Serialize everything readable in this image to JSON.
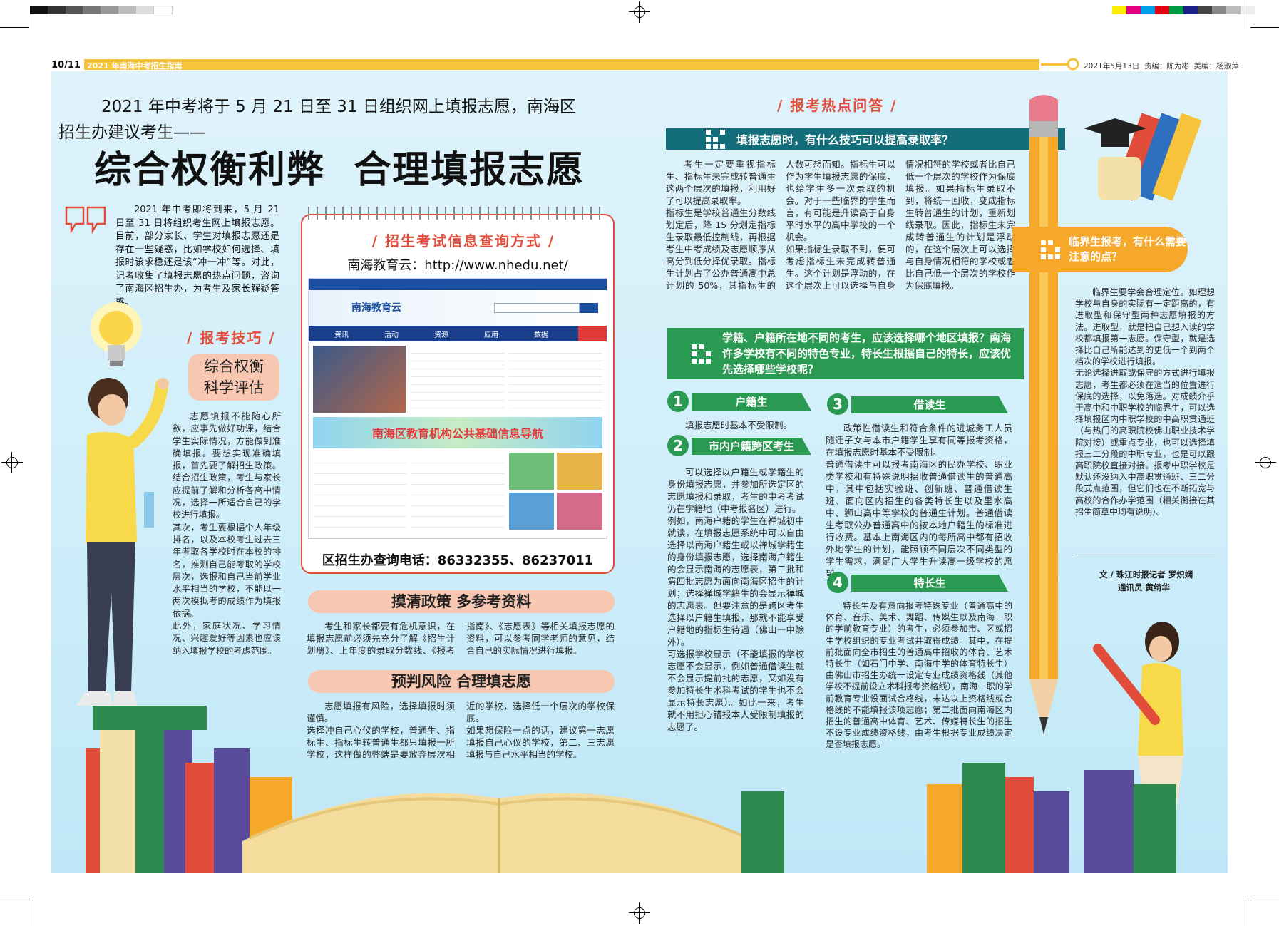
{
  "header": {
    "page_num": "10/11",
    "section": "2021 年南海中考招生指南",
    "date": "2021年5月13日",
    "editor": "责编：陈为彬",
    "designer": "美编：杨淑萍"
  },
  "headline": {
    "intro_line1": "2021 年中考将于 5 月 21 日至 31 日组织网上填报志愿，南海区",
    "intro_line2": "招生办建议考生——",
    "main": "综合权衡利弊  合理填报志愿"
  },
  "lead": "2021 年中考即将到来，5 月 21 日至 31 日将组织考生网上填报志愿。目前，部分家长、学生对填报志愿还是存在一些疑惑，比如学校如何选择、填报时该求稳还是该“冲一冲”等。对此，记者收集了填报志愿的热点问题，咨询了南海区招生办，为考生及家长解疑答惑。",
  "tips": {
    "label": "/ 报考技巧 /",
    "pill": "综合权衡\n科学评估",
    "text": "志愿填报不能随心所欲，应事先做好功课，结合学生实际情况，方能做到准确填报。要想实现准确填报，首先要了解招生政策。结合招生政策，考生与家长应提前了解和分析各高中情况，选择一所适合自己的学校进行填报。\n其次，考生要根据个人年级排名，以及本校考生过去三年考取各学校时在本校的排名，推测自己能考取的学校层次，选报和自己当前学业水平相当的学校，不能以一两次模拟考的成绩作为填报依据。\n此外，家庭状况、学习情况、兴趣爱好等因素也应该纳入填报学校的考虑范围。"
  },
  "info_box": {
    "title": "/ 招生考试信息查询方式 /",
    "site": "南海教育云：http://www.nhedu.net/",
    "phone": "区招生办查询电话：86332355、86237011",
    "shot_logo": "南海教育云",
    "shot_banner": "南海区教育机构公共基础信息导航",
    "shot_nav": [
      "资讯",
      "活动",
      "资源",
      "应用",
      "数据"
    ]
  },
  "policy": {
    "pill": "摸清政策 多参考资料",
    "text": "考生和家长都要有危机意识，在填报志愿前必须先充分了解《招生计划册》、上年度的录取分数线、《报考指南》、《志愿表》等相关填报志愿的资料，可以参考同学老师的意见，结合自己的实际情况进行填报。"
  },
  "risk": {
    "pill": "预判风险 合理填志愿",
    "text": "志愿填报有风险，选择填报时须谨慎。\n选择冲自己心仪的学校，普通生、指标生、指标生转普通生都只填报一所学校，这样做的弊端是要放弃层次相近的学校，选择低一个层次的学校保底。\n如果想保险一点的话，建议第一志愿填报自己心仪的学校，第二、三志愿填报与自己水平相当的学校。"
  },
  "hot": {
    "label": "/ 报考热点问答 /",
    "q1": "填报志愿时，有什么技巧可以提高录取率？",
    "a1": "考生一定要重视指标生、指标生未完成转普通生这两个层次的填报，利用好了可以提高录取率。\n指标生是学校普通生分数线划定后，降 15 分划定指标生录取最低控制线，再根据考生中考成绩及志愿顺序从高分到低分择优录取。指标生计划占了公办普通高中总计划的 50%，其指标生的人数可想而知。指标生可以作为学生填报志愿的保底，也给学生多一次录取的机会。对于一些临界的学生而言，有可能是升读高于自身平时水平的高中学校的一个机会。\n如果指标生录取不到，便可考虑指标生未完成转普通生。这个计划是浮动的，在这个层次上可以选择与自身情况相符的学校或者比自己低一个层次的学校作为保底填报。如果指标生录取不到，将统一回收，变成指标生转普通生的计划，重新划线录取。因此，指标生未完成转普通生的计划是浮动的，在这个层次上可以选择与自身情况相符的学校或者比自己低一个层次的学校作为保底填报。",
    "q2": "学籍、户籍所在地不同的考生，应该选择哪个地区填报？南海许多学校有不同的特色专业，特长生根据自己的特长，应该优先选择哪些学校呢？",
    "q3": "临界生报考，有什么需要注意的点？"
  },
  "cats": [
    {
      "num": "1",
      "title": "户籍生",
      "text": "填报志愿时基本不受限制。"
    },
    {
      "num": "2",
      "title": "市内户籍跨区考生",
      "text": "可以选择以户籍生或学籍生的身份填报志愿，并参加所选定区的志愿填报和录取，考生的中考考试仍在学籍地（中考报名区）进行。\n例如，南海户籍的学生在禅城初中就读，在填报志愿系统中可以自由选择以南海户籍生或以禅城学籍生的身份填报志愿，选择南海户籍生的会显示南海的志愿表，第二批和第四批志愿为面向南海区招生的计划；选择禅城学籍生的会显示禅城的志愿表。但要注意的是跨区考生选择以户籍生填报，那就不能享受户籍地的指标生待遇（佛山一中除外）。\n可选报学校显示（不能填报的学校志愿不会显示，例如普通借读生就不会显示提前批的志愿，又如没有参加特长生术科考试的学生也不会显示特长志愿）。如此一来，考生就不用担心错报本人受限制填报的志愿了。"
    },
    {
      "num": "3",
      "title": "借读生",
      "text": "政策性借读生和符合条件的进城务工人员随迁子女与本市户籍学生享有同等报考资格，在填报志愿时基本不受限制。\n普通借读生可以报考南海区的民办学校、职业类学校和有特殊说明招收普通借读生的普通高中，其中包括实验班、创新班、普通借读生班、面向区内招生的各类特长生以及里水高中、狮山高中等学校的普通生计划。普通借读生考取公办普通高中的按本地户籍生的标准进行收费。基本上南海区内的每所高中都有招收外地学生的计划，能照顾不同层次不同类型的学生需求，满足广大学生升读高一级学校的愿望。"
    },
    {
      "num": "4",
      "title": "特长生",
      "text": "特长生及有意向报考特殊专业（普通高中的体育、音乐、美术、舞蹈、传媒生以及南海一职的学前教育专业）的考生，必须参加市、区或招生学校组织的专业考试并取得成绩。其中，在提前批面向全市招生的普通高中招收的体育、艺术特长生（如石门中学、南海中学的体育特长生）由佛山市招生办统一设定专业成绩资格线（其他学校不提前设立术科报考资格线），南海一职的学前教育专业设面试合格线，未达以上资格线或合格线的不能填报该项志愿；第二批面向南海区内招生的普通高中体育、艺术、传媒特长生的招生不设专业成绩资格线，由考生根据专业成绩决定是否填报志愿。"
    }
  ],
  "borderline": {
    "text": "临界生要学会合理定位。如理想学校与自身的实际有一定距离的，有进取型和保守型两种志愿填报的方法。进取型，就是把自己想入读的学校都填报第一志愿。保守型，就是选择比自己所能达到的更低一个到两个档次的学校进行填报。\n无论选择进取或保守的方式进行填报志愿，考生都必须在适当的位置进行保底的选择，以免落选。对成绩介乎于高中和中职学校的临界生，可以选择填报区内中职学校的中高职贯通班（与热门的高职院校佛山职业技术学院对接）或重点专业，也可以选择填报三二分段的中职专业，也是可以跟高职院校直接对接。报考中职学校是默认还没纳入中高职贯通班、三二分段式点范围，但它们也在不断拓宽与高校的合作办学范围（相关衔接在其招生简章中均有说明）。",
    "byline1": "文 / 珠江时报记者 罗炽娴",
    "byline2": "通讯员 黄绮华"
  }
}
